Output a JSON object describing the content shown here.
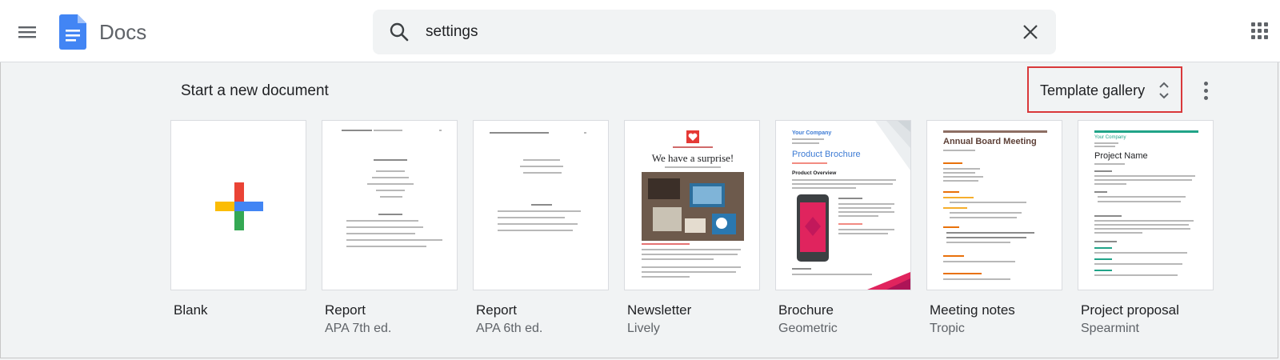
{
  "header": {
    "app_title": "Docs",
    "search_value": "settings"
  },
  "section": {
    "title": "Start a new document",
    "template_gallery_label": "Template gallery"
  },
  "templates": [
    {
      "name": "Blank",
      "sub": ""
    },
    {
      "name": "Report",
      "sub": "APA 7th ed."
    },
    {
      "name": "Report",
      "sub": "APA 6th ed."
    },
    {
      "name": "Newsletter",
      "sub": "Lively"
    },
    {
      "name": "Brochure",
      "sub": "Geometric"
    },
    {
      "name": "Meeting notes",
      "sub": "Tropic"
    },
    {
      "name": "Project proposal",
      "sub": "Spearmint"
    }
  ],
  "thumb_text": {
    "newsletter_heading": "We have a surprise!",
    "brochure_company": "Your Company",
    "brochure_title": "Product Brochure",
    "brochure_overview": "Product Overview",
    "meeting_title": "Annual Board Meeting",
    "proposal_company": "Your Company",
    "proposal_title": "Project Name"
  },
  "colors": {
    "accent_red": "#d9383a",
    "docs_blue": "#4285f4",
    "brochure_blue": "#3d7bd4",
    "brochure_pink": "#e0245e",
    "meeting_orange": "#e8710a",
    "proposal_teal": "#21a488"
  },
  "icons": {
    "menu": "hamburger-menu-icon",
    "logo": "docs-logo-icon",
    "search": "search-icon",
    "clear": "close-icon",
    "apps": "apps-grid-icon",
    "gallery": "unfold-icon",
    "more": "more-vert-icon"
  }
}
